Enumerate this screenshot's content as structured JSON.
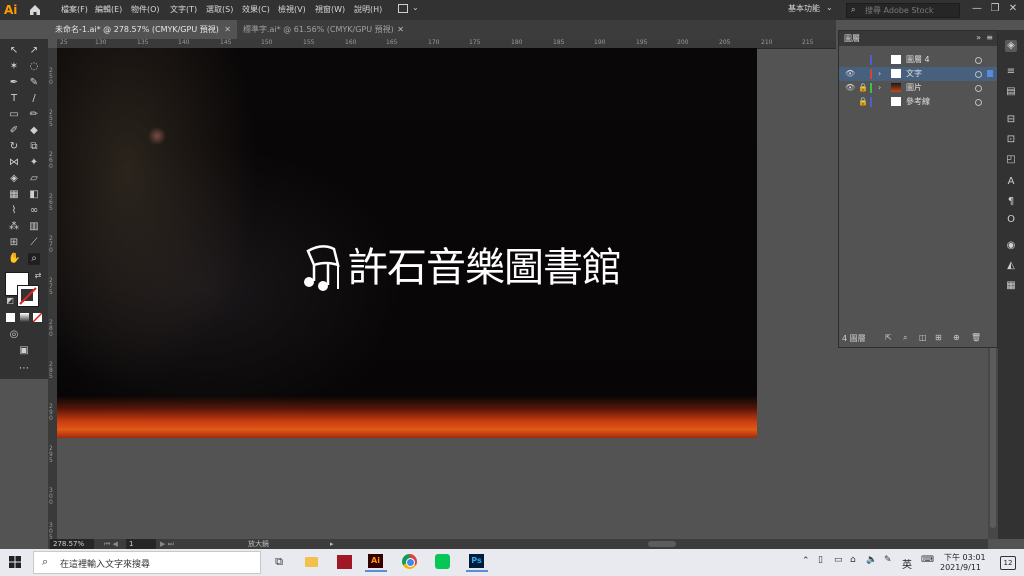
{
  "app": {
    "logo": "Ai"
  },
  "menu": [
    "檔案(F)",
    "編輯(E)",
    "物件(O)",
    "文字(T)",
    "選取(S)",
    "效果(C)",
    "檢視(V)",
    "視窗(W)",
    "說明(H)"
  ],
  "workspace": "基本功能",
  "stock_search_placeholder": "搜尋 Adobe Stock",
  "tabs": [
    {
      "label": "未命名-1.ai* @ 278.57% (CMYK/GPU 預視)"
    },
    {
      "label": "標準字.ai* @ 61.56% (CMYK/GPU 預視)"
    }
  ],
  "ruler_h": [
    "25",
    "130",
    "135",
    "140",
    "145",
    "150",
    "155",
    "160",
    "165",
    "170",
    "175",
    "180",
    "185",
    "190",
    "195",
    "200",
    "205",
    "210",
    "215"
  ],
  "ruler_v": [
    "250",
    "255",
    "260",
    "265",
    "270",
    "275",
    "280",
    "285",
    "290",
    "295",
    "300",
    "305"
  ],
  "artwork": {
    "logo_text": "許石音樂圖書館"
  },
  "layers_panel": {
    "title": "圖層",
    "layers": [
      {
        "name": "圖層 4",
        "color": "#4f5cd4",
        "visible": false,
        "locked": false,
        "selected": false
      },
      {
        "name": "文字",
        "color": "#d0453a",
        "visible": true,
        "locked": false,
        "selected": true
      },
      {
        "name": "圖片",
        "color": "#3fbf4a",
        "visible": true,
        "locked": true,
        "selected": false
      },
      {
        "name": "參考線",
        "color": "#4f5cd4",
        "visible": false,
        "locked": true,
        "selected": false
      }
    ],
    "layer_count": "4 圖層"
  },
  "status": {
    "zoom": "278.57%",
    "page": "1",
    "tool": "放大鏡"
  },
  "taskbar": {
    "search_placeholder": "在這裡輸入文字來搜尋",
    "ime": "英",
    "time": "下午 03:01",
    "date": "2021/9/11",
    "notifications": "12"
  }
}
